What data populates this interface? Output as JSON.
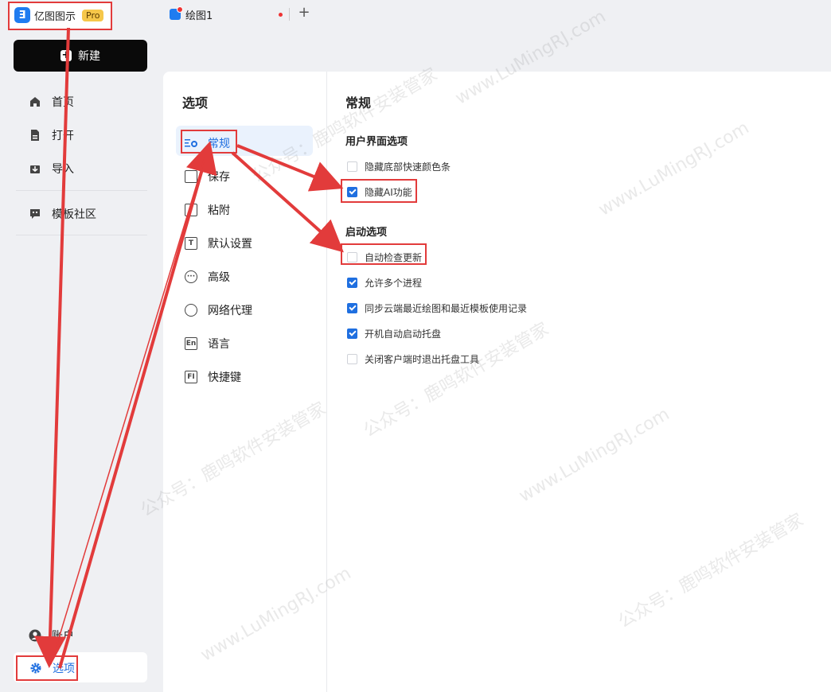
{
  "app": {
    "name": "亿图图示",
    "badge": "Pro",
    "logo_glyph": "Ǝ"
  },
  "tabs": {
    "document": "绘图1",
    "add": "+"
  },
  "sidebar": {
    "new_button": "新建",
    "items": [
      {
        "label": "首页",
        "icon": "home-icon"
      },
      {
        "label": "打开",
        "icon": "file-icon"
      },
      {
        "label": "导入",
        "icon": "import-icon"
      },
      {
        "label": "模板社区",
        "icon": "community-icon"
      }
    ],
    "account": "账户",
    "options": "选项"
  },
  "options_panel": {
    "title": "选项",
    "categories": [
      {
        "label": "常规",
        "icon": "general-icon",
        "active": true
      },
      {
        "label": "保存",
        "icon": "save-icon"
      },
      {
        "label": "粘附",
        "icon": "snap-icon"
      },
      {
        "label": "默认设置",
        "icon": "text-default-icon"
      },
      {
        "label": "高级",
        "icon": "more-icon"
      },
      {
        "label": "网络代理",
        "icon": "globe-icon"
      },
      {
        "label": "语言",
        "icon": "language-icon"
      },
      {
        "label": "快捷键",
        "icon": "shortcut-icon"
      }
    ]
  },
  "general": {
    "title": "常规",
    "ui_group": {
      "title": "用户界面选项",
      "options": [
        {
          "label": "隐藏底部快速颜色条",
          "checked": false
        },
        {
          "label": "隐藏AI功能",
          "checked": true
        }
      ]
    },
    "startup_group": {
      "title": "启动选项",
      "options": [
        {
          "label": "自动检查更新",
          "checked": false
        },
        {
          "label": "允许多个进程",
          "checked": true
        },
        {
          "label": "同步云端最近绘图和最近模板使用记录",
          "checked": true
        },
        {
          "label": "开机自动启动托盘",
          "checked": true
        },
        {
          "label": "关闭客户端时退出托盘工具",
          "checked": false
        }
      ]
    }
  },
  "watermarks": [
    "公众号：鹿鸣软件安装管家",
    "www.LuMingRJ.com"
  ],
  "colors": {
    "accent": "#1f6fe0",
    "annotation": "#e23b3b"
  }
}
